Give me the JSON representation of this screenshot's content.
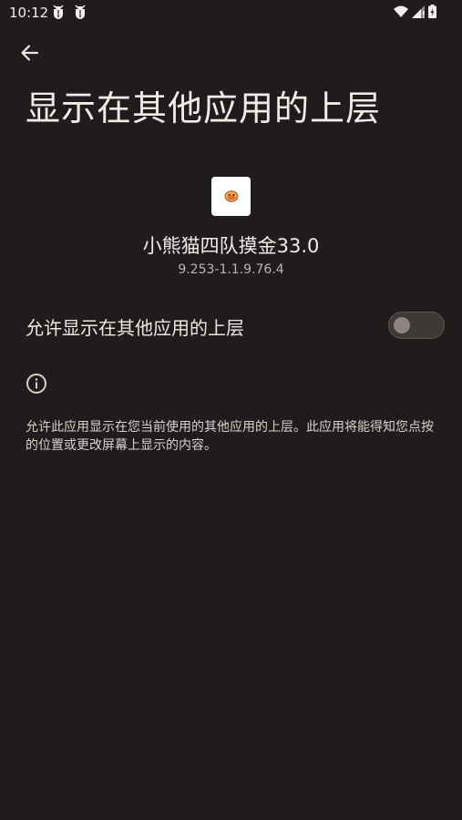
{
  "status_bar": {
    "time": "10:12",
    "notifications": [
      "bug-icon",
      "bug-icon"
    ],
    "right_icons": [
      "wifi-icon",
      "signal-icon",
      "battery-icon"
    ]
  },
  "header": {
    "back_icon": "arrow-left-icon",
    "title": "显示在其他应用的上层"
  },
  "app": {
    "icon": "app-icon",
    "name": "小熊猫四队摸金33.0",
    "version": "9.253-1.1.9.76.4"
  },
  "permission": {
    "label": "允许显示在其他应用的上层",
    "enabled": false
  },
  "info": {
    "icon": "info-icon",
    "description": "允许此应用显示在您当前使用的其他应用的上层。此应用将能得知您点按的位置或更改屏幕上显示的内容。"
  },
  "colors": {
    "background": "#201c1c",
    "text_primary": "#f0ecea",
    "text_secondary": "#bcb5b3",
    "switch_track": "#3d3937",
    "switch_thumb": "#8c8584"
  }
}
